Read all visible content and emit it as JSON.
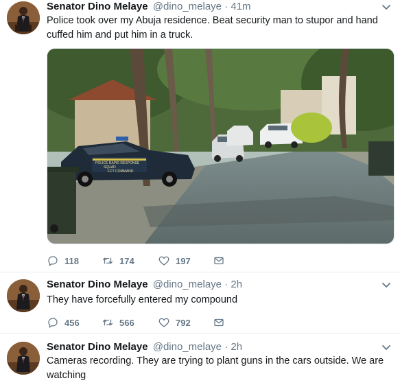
{
  "tweets": [
    {
      "name": "Senator Dino Melaye",
      "handle": "@dino_melaye",
      "dot": "·",
      "time": "41m",
      "text": "Police took over my Abuja residence. Beat security man to stupor and hand cuffed him and put him in a truck.",
      "replies": "118",
      "retweets": "174",
      "likes": "197",
      "media": {
        "car_markings": [
          "POLICE RAPID RESPONSE",
          "SQUAD",
          "FCT COMMAND"
        ]
      }
    },
    {
      "name": "Senator Dino Melaye",
      "handle": "@dino_melaye",
      "dot": "·",
      "time": "2h",
      "text": "They have forcefully entered my compound",
      "replies": "456",
      "retweets": "566",
      "likes": "792"
    },
    {
      "name": "Senator Dino Melaye",
      "handle": "@dino_melaye",
      "dot": "·",
      "time": "2h",
      "text": "Cameras recording. They are trying to plant guns in the cars outside. We are watching"
    }
  ],
  "icons": {
    "reply": "reply-icon",
    "retweet": "retweet-icon",
    "like": "heart-icon",
    "dm": "envelope-icon",
    "caret": "chevron-down-icon"
  },
  "colors": {
    "text": "#14171a",
    "secondary": "#657786",
    "divider": "#e6ecf0"
  }
}
